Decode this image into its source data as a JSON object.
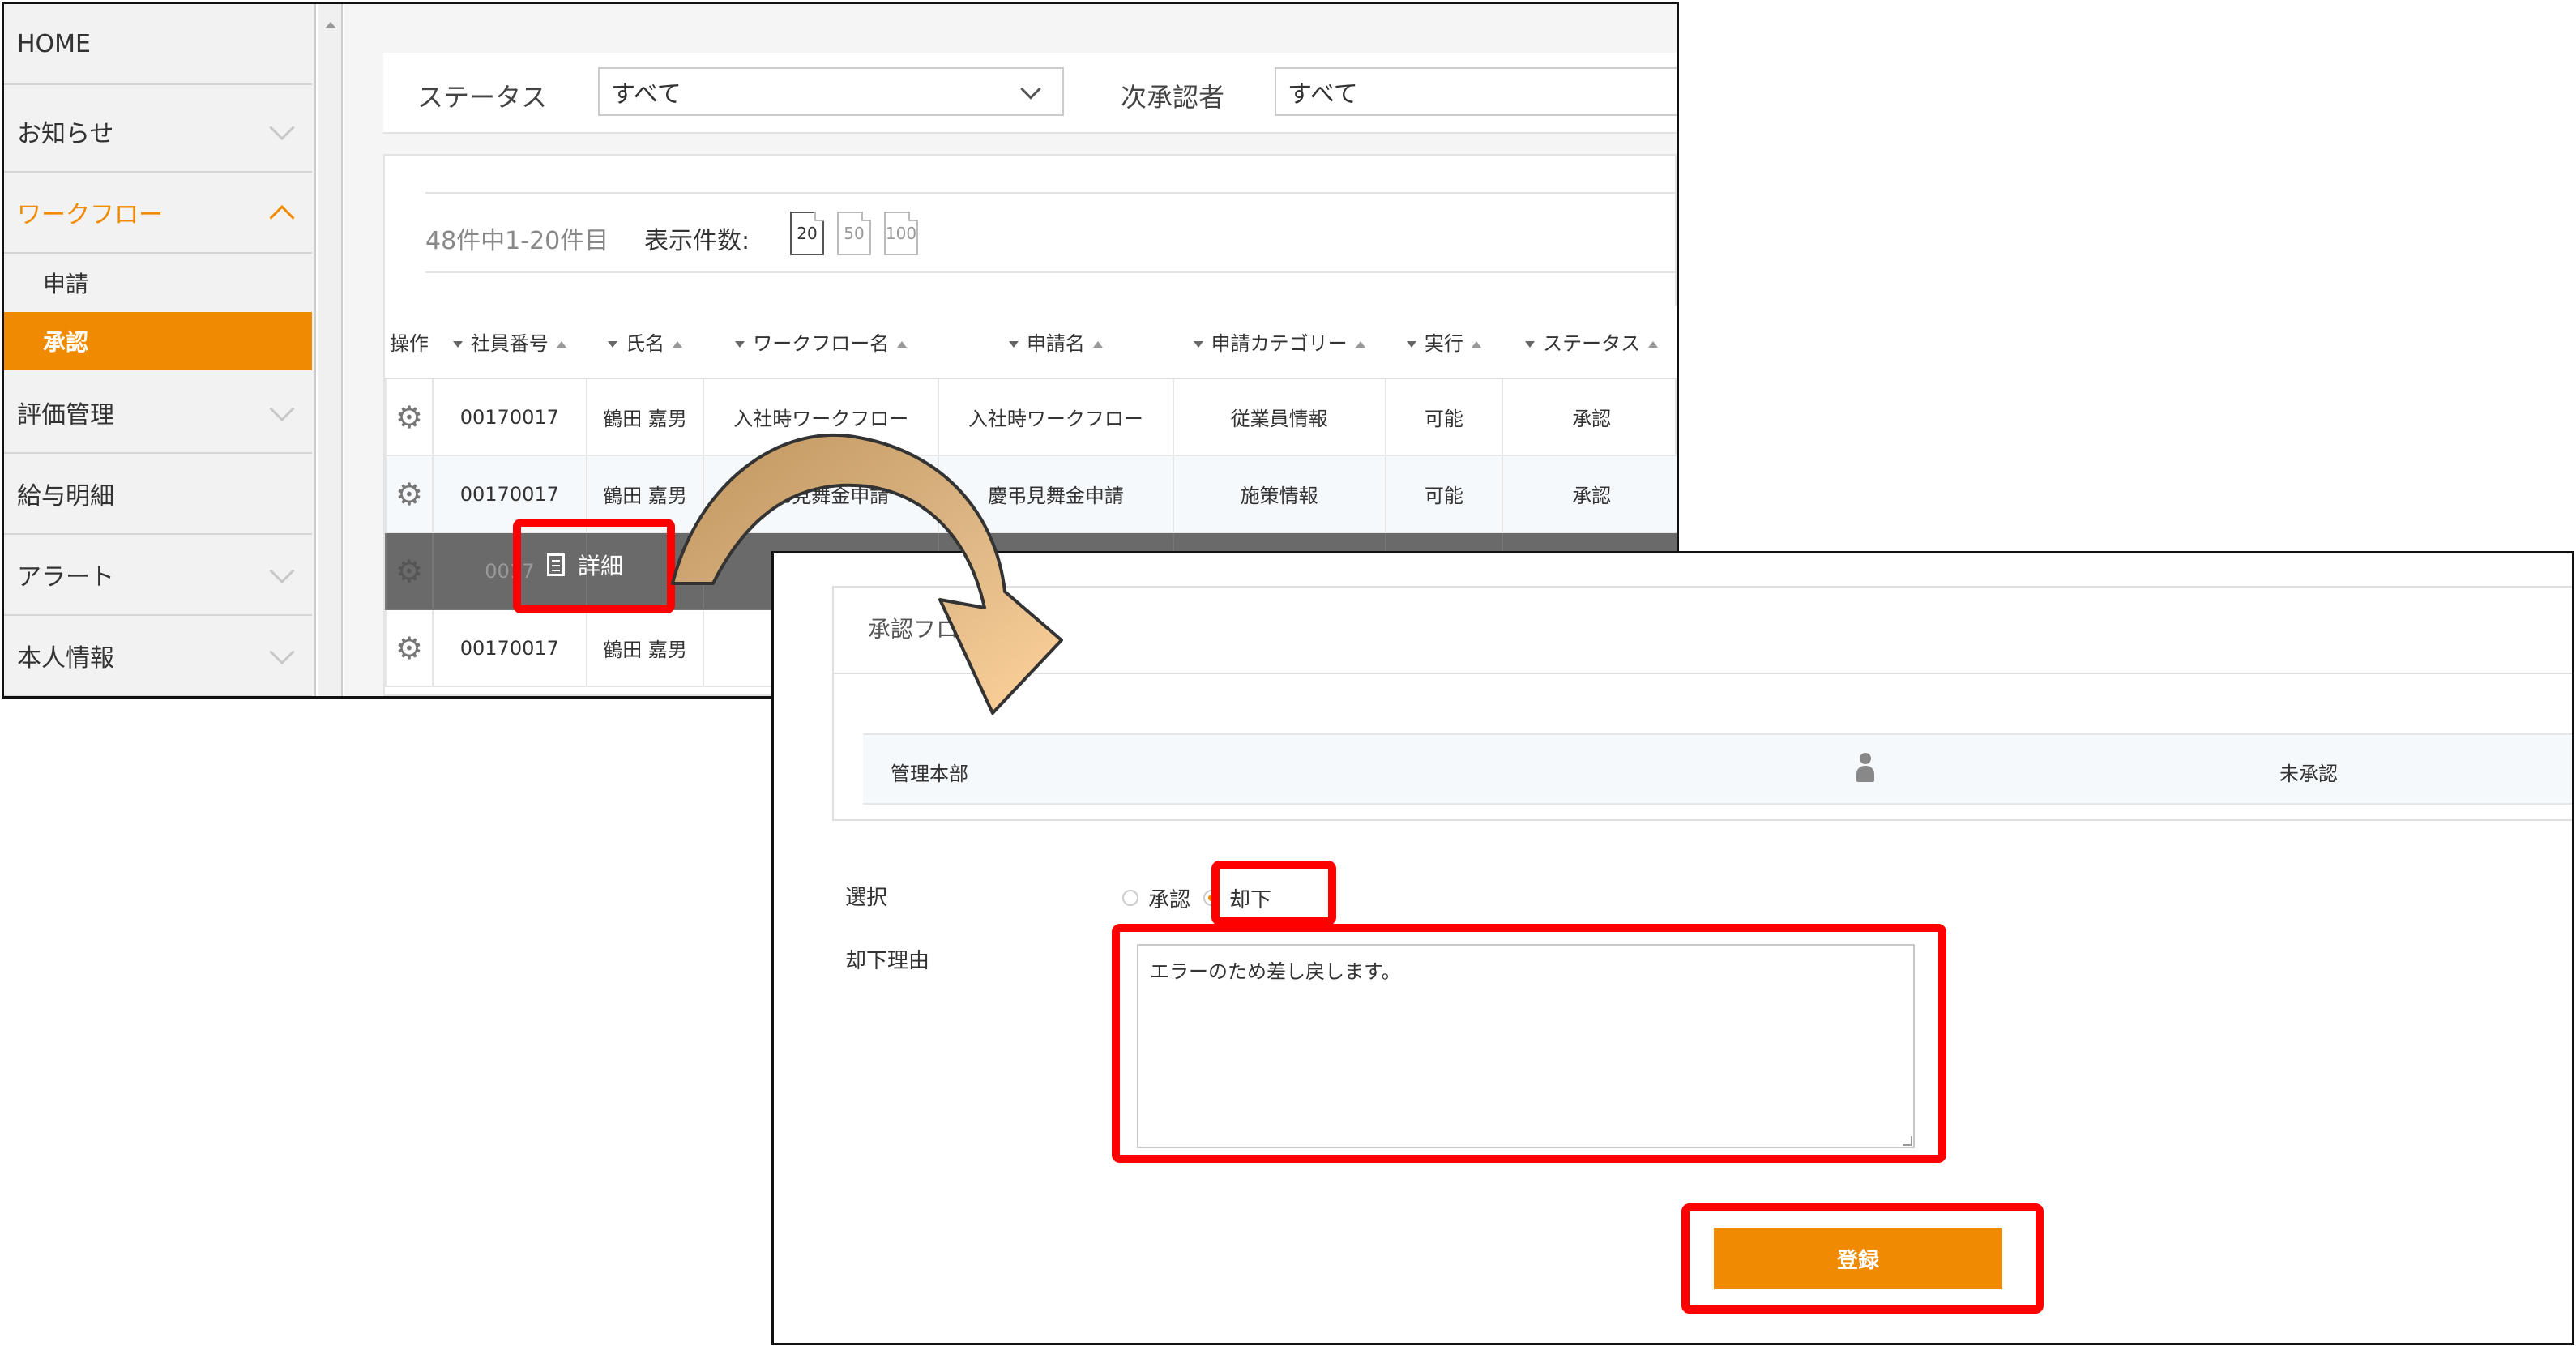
{
  "sidebar": {
    "items": [
      {
        "label": "HOME"
      },
      {
        "label": "お知らせ"
      },
      {
        "label": "ワークフロー"
      },
      {
        "label": "評価管理"
      },
      {
        "label": "給与明細"
      },
      {
        "label": "アラート"
      },
      {
        "label": "本人情報"
      }
    ],
    "sub_items": [
      {
        "label": "申請"
      },
      {
        "label": "承認"
      }
    ]
  },
  "filters": {
    "status_label": "ステータス",
    "status_value": "すべて",
    "approver_label": "次承認者",
    "approver_value": "すべて"
  },
  "paging": {
    "count_text": "48件中1-20件目",
    "per_page_label": "表示件数:",
    "options": [
      "20",
      "50",
      "100"
    ],
    "selected": "20"
  },
  "table": {
    "headers": [
      "操作",
      "社員番号",
      "氏名",
      "ワークフロー名",
      "申請名",
      "申請カテゴリー",
      "実行",
      "ステータス"
    ],
    "rows": [
      [
        "00170017",
        "鶴田 嘉男",
        "入社時ワークフロー",
        "入社時ワークフロー",
        "従業員情報",
        "可能",
        "承認"
      ],
      [
        "00170017",
        "鶴田 嘉男",
        "慶弔見舞金申請",
        "慶弔見舞金申請",
        "施策情報",
        "可能",
        "承認"
      ],
      [
        "0017",
        "",
        "",
        "",
        "",
        "",
        ""
      ],
      [
        "00170017",
        "鶴田 嘉男",
        "",
        "",
        "",
        "",
        ""
      ]
    ]
  },
  "row_menu": {
    "detail_label": "詳細"
  },
  "approval": {
    "flow_title": "承認フロー",
    "dept": "管理本部",
    "status": "未承認",
    "select_label": "選択",
    "options": [
      "承認",
      "却下"
    ],
    "selected": "却下",
    "reason_label": "却下理由",
    "reason_value": "エラーのため差し戻します。",
    "submit_label": "登録"
  },
  "colors": {
    "accent": "#f08a00",
    "highlight": "#ff0000"
  }
}
